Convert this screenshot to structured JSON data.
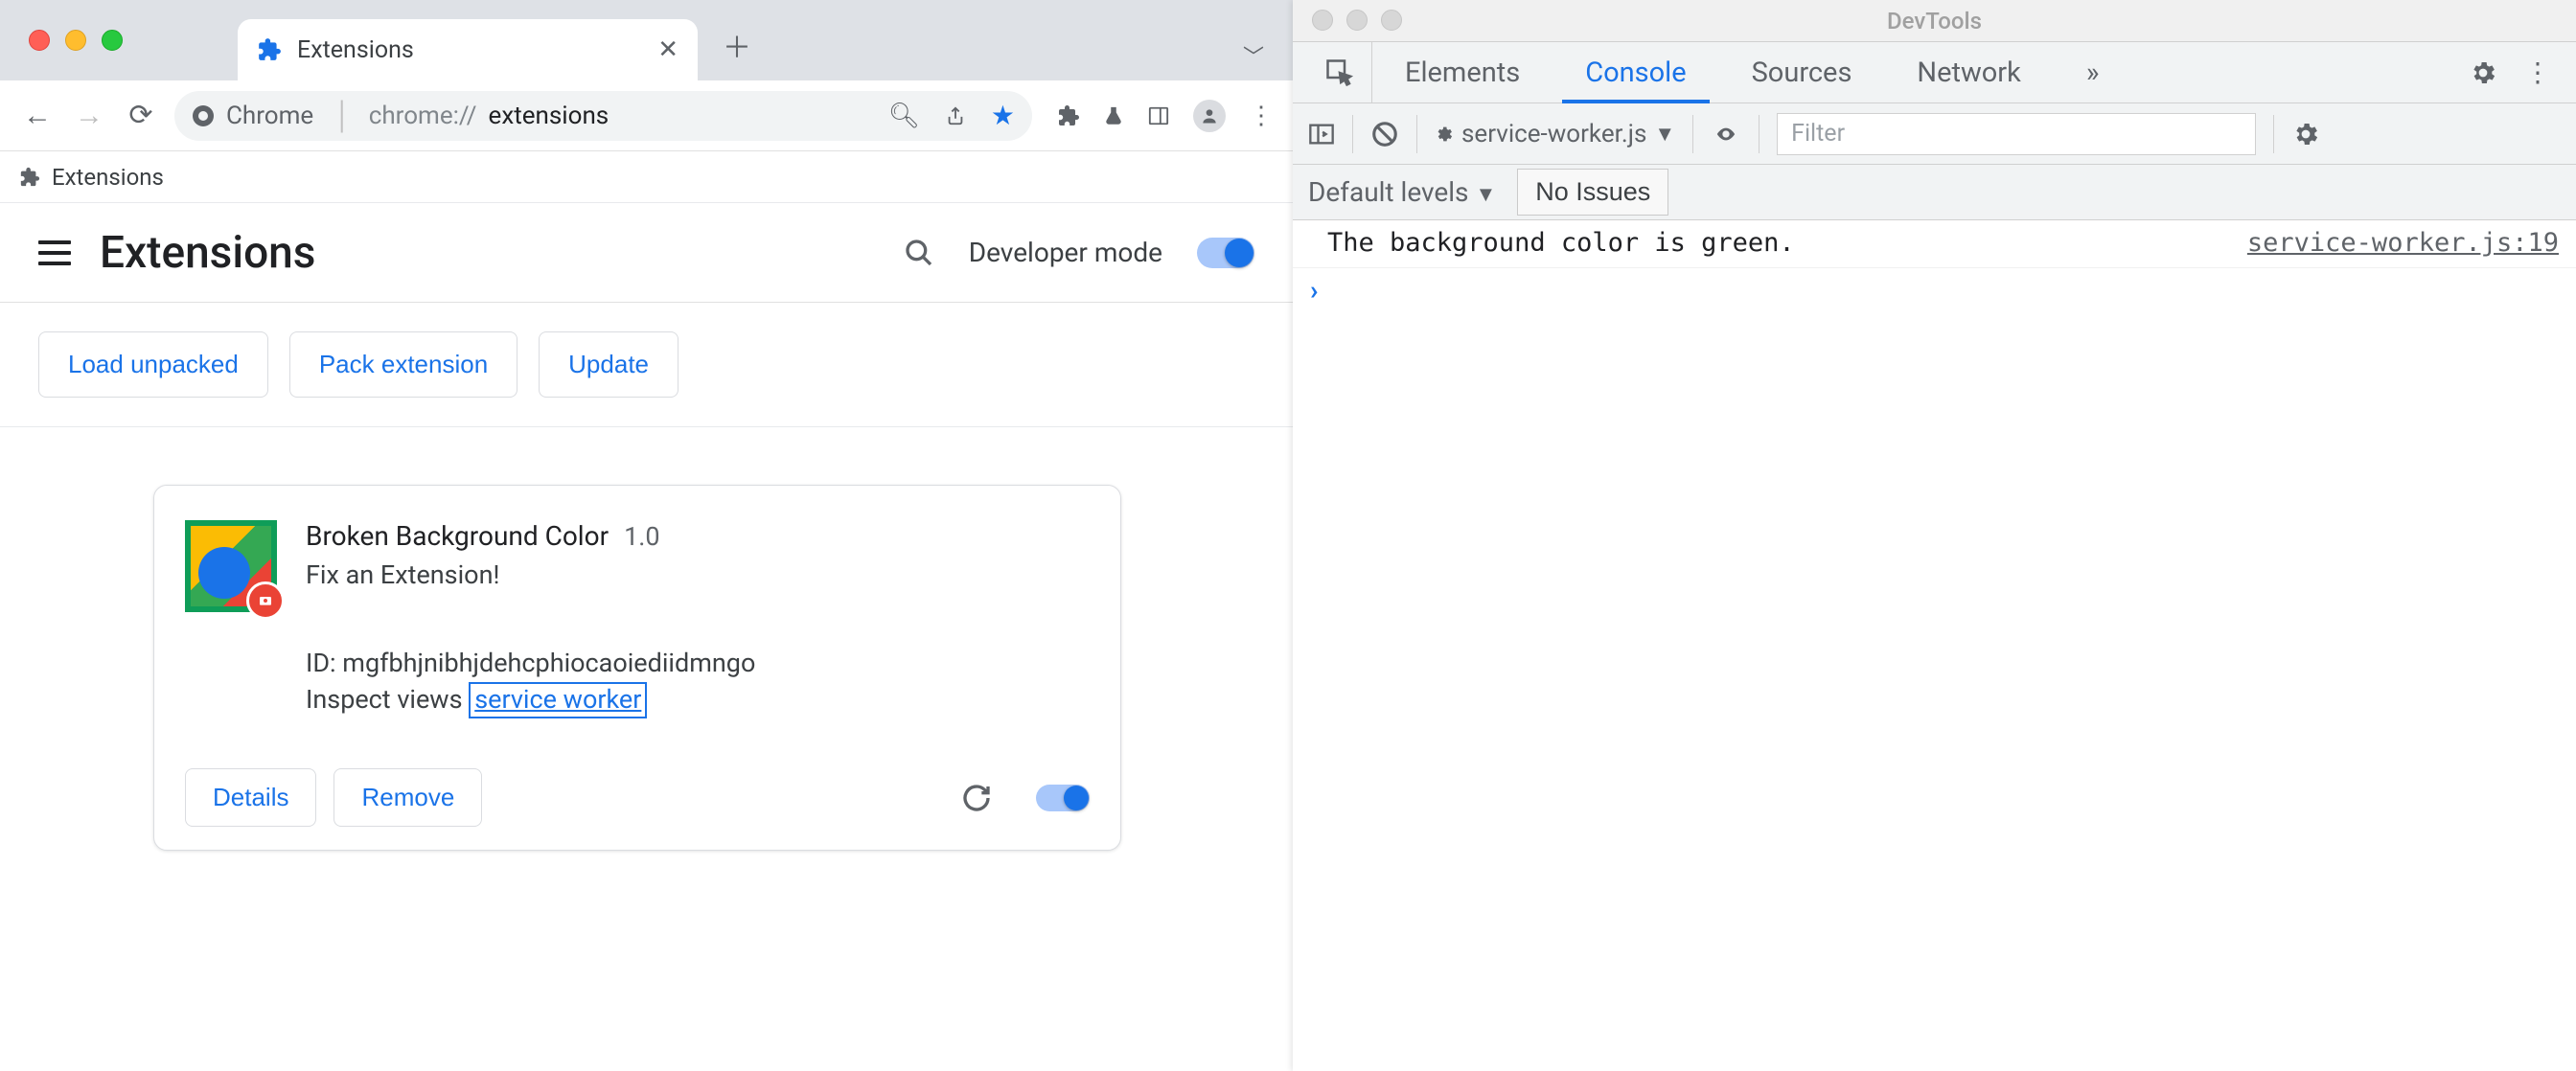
{
  "chrome": {
    "tab": {
      "title": "Extensions"
    },
    "omnibox": {
      "scheme_label": "Chrome",
      "url_prefix": "chrome://",
      "url_path": "extensions"
    },
    "bookmark": {
      "label": "Extensions"
    },
    "header": {
      "title": "Extensions",
      "dev_mode_label": "Developer mode"
    },
    "actions": {
      "load_unpacked": "Load unpacked",
      "pack_extension": "Pack extension",
      "update": "Update"
    },
    "card": {
      "name": "Broken Background Color",
      "version": "1.0",
      "description": "Fix an Extension!",
      "id_label": "ID: mgfbhjnibhjdehcphiocaoiediidmngo",
      "inspect_label": "Inspect views ",
      "service_worker_link": "service worker",
      "details": "Details",
      "remove": "Remove"
    }
  },
  "devtools": {
    "title": "DevTools",
    "tabs": {
      "elements": "Elements",
      "console": "Console",
      "sources": "Sources",
      "network": "Network"
    },
    "context": "service-worker.js",
    "filter_placeholder": "Filter",
    "levels_label": "Default levels",
    "no_issues": "No Issues",
    "log_message": "The background color is green.",
    "log_source": "service-worker.js:19"
  }
}
